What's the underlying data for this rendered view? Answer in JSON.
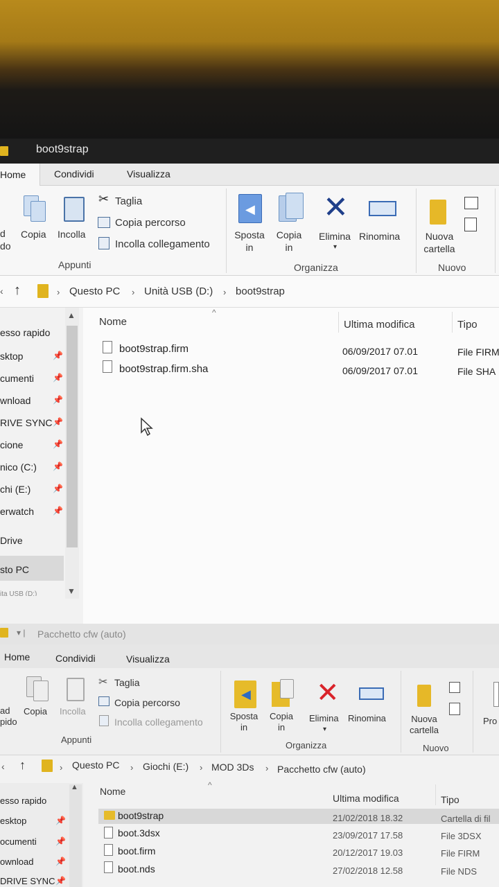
{
  "window1": {
    "title": "boot9strap",
    "tabs": [
      "Home",
      "Condividi",
      "Visualizza"
    ],
    "ribbon": {
      "copy_label": "Copia",
      "paste_label": "Incolla",
      "cut_label": "Taglia",
      "copy_path_label": "Copia percorso",
      "paste_link_label": "Incolla collegamento",
      "clipboard_group": "Appunti",
      "move_to_label": "Sposta in",
      "copy_to_label": "Copia in",
      "delete_label": "Elimina",
      "rename_label": "Rinomina",
      "organize_group": "Organizza",
      "new_folder_label": "Nuova cartella",
      "new_group": "Nuovo",
      "partial_left_1": "d",
      "partial_left_2": "do"
    },
    "breadcrumb": [
      "Questo PC",
      "Unità USB (D:)",
      "boot9strap"
    ],
    "nav_items": [
      "esso rapido",
      "sktop",
      "cumenti",
      "wnload",
      "RIVE SYNC",
      "cione",
      "nico (C:)",
      "chi (E:)",
      "erwatch",
      "Drive",
      "sto PC",
      "ita USB (D:)"
    ],
    "columns": [
      "Nome",
      "Ultima modifica",
      "Tipo"
    ],
    "files": [
      {
        "name": "boot9strap.firm",
        "date": "06/09/2017 07.01",
        "type": "File FIRM"
      },
      {
        "name": "boot9strap.firm.sha",
        "date": "06/09/2017 07.01",
        "type": "File SHA"
      }
    ]
  },
  "window2": {
    "title": "Pacchetto cfw (auto)",
    "tabs": [
      "Home",
      "Condividi",
      "Visualizza"
    ],
    "ribbon": {
      "copy_label": "Copia",
      "paste_label": "Incolla",
      "cut_label": "Taglia",
      "copy_path_label": "Copia percorso",
      "paste_link_label": "Incolla collegamento",
      "clipboard_group": "Appunti",
      "move_to_label": "Sposta in",
      "copy_to_label": "Copia in",
      "delete_label": "Elimina",
      "rename_label": "Rinomina",
      "organize_group": "Organizza",
      "new_folder_label": "Nuova cartella",
      "new_group": "Nuovo",
      "properties_partial": "Pro",
      "partial_left_1": "ad",
      "partial_left_2": "pido"
    },
    "breadcrumb": [
      "Questo PC",
      "Giochi (E:)",
      "MOD 3Ds",
      "Pacchetto cfw (auto)"
    ],
    "nav_items": [
      "esso rapido",
      "esktop",
      "ocumenti",
      "ownload",
      "DRIVE SYNC"
    ],
    "columns": [
      "Nome",
      "Ultima modifica",
      "Tipo"
    ],
    "files": [
      {
        "name": "boot9strap",
        "date": "21/02/2018 18.32",
        "type": "Cartella di fil"
      },
      {
        "name": "boot.3dsx",
        "date": "23/09/2017 17.58",
        "type": "File 3DSX"
      },
      {
        "name": "boot.firm",
        "date": "20/12/2017 19.03",
        "type": "File FIRM"
      },
      {
        "name": "boot.nds",
        "date": "27/02/2018 12.58",
        "type": "File NDS"
      }
    ]
  },
  "icons": [
    "folder-icon",
    "copy-icon",
    "paste-icon",
    "scissors-icon",
    "copy-path-icon",
    "paste-shortcut-icon",
    "move-to-icon",
    "copy-to-icon",
    "delete-icon",
    "rename-icon",
    "new-folder-icon",
    "new-item-icon",
    "up-arrow-icon",
    "pin-icon",
    "file-icon",
    "mouse-cursor-icon"
  ],
  "colors": {
    "folder": "#e0b41f",
    "delete": "#1f3f8a",
    "delete_w2": "#d9232a",
    "accent_blue": "#4a73a8"
  }
}
